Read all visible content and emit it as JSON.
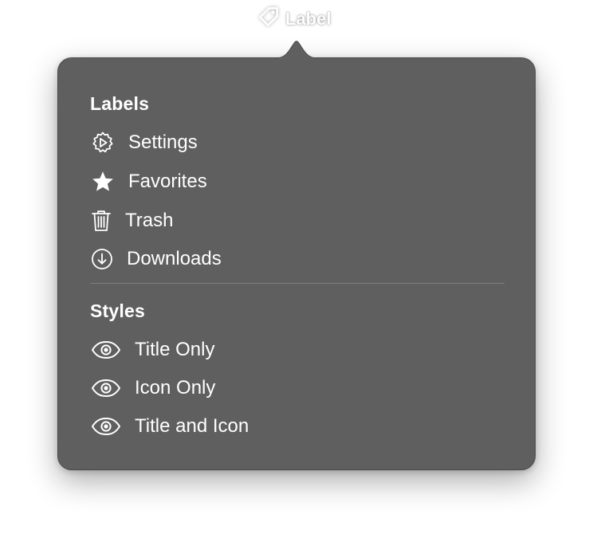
{
  "toolbar": {
    "label": "Label",
    "icon": "tag-icon"
  },
  "popover": {
    "sections": [
      {
        "title": "Labels",
        "items": [
          {
            "label": "Settings",
            "icon": "gear-icon"
          },
          {
            "label": "Favorites",
            "icon": "star-icon"
          },
          {
            "label": "Trash",
            "icon": "trash-icon"
          },
          {
            "label": "Downloads",
            "icon": "download-icon"
          }
        ]
      },
      {
        "title": "Styles",
        "items": [
          {
            "label": "Title Only",
            "icon": "eye-icon"
          },
          {
            "label": "Icon Only",
            "icon": "eye-icon"
          },
          {
            "label": "Title and Icon",
            "icon": "eye-icon"
          }
        ]
      }
    ]
  },
  "colors": {
    "popover_background": "#5f5f5f",
    "text": "#ffffff",
    "separator": "#7c7c7c"
  }
}
